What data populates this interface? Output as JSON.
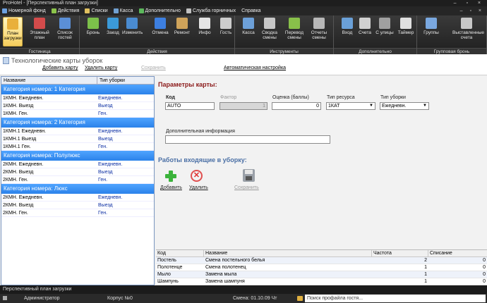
{
  "window": {
    "title": "ProHotel - [Перспективный план загрузки]",
    "controls": "– ▫ ×"
  },
  "menu": [
    {
      "label": "Номерной фонд",
      "color": "#6ca0e0"
    },
    {
      "label": "Действия",
      "color": "#8bc34a"
    },
    {
      "label": "Списки",
      "color": "#e0c060"
    },
    {
      "label": "Касса",
      "color": "#70a0d0"
    },
    {
      "label": "Дополнительно",
      "color": "#5cb85c"
    },
    {
      "label": "Служба горничных",
      "color": "#c0c0c0"
    },
    {
      "label": "Справка",
      "color": ""
    }
  ],
  "ribbon": {
    "groups": [
      "Гостиница",
      "Действия",
      "Инструменты",
      "Дополнительно",
      "Групповая бронь"
    ],
    "buttons": [
      {
        "label": "План загрузки",
        "color": "#e9b03b"
      },
      {
        "label": "Этажный план",
        "color": "#d34b4b"
      },
      {
        "label": "Список гостей",
        "color": "#5b8fd6"
      },
      {
        "label": "Бронь",
        "color": "#7cc04a"
      },
      {
        "label": "Заезд",
        "color": "#3b9ad9"
      },
      {
        "label": "Изменить",
        "color": "#4a8bd0"
      },
      {
        "label": "Отмена",
        "color": "#3d7fe0"
      },
      {
        "label": "Ремонт",
        "color": "#cfa35a"
      },
      {
        "label": "Инфо",
        "color": "#e4e4e4"
      },
      {
        "label": "Гость",
        "color": "#cccccc"
      },
      {
        "label": "Касса",
        "color": "#6da0d8"
      },
      {
        "label": "Сводка смены",
        "color": "#c8c8c8"
      },
      {
        "label": "Перевод смены",
        "color": "#88c04a"
      },
      {
        "label": "Отчеты смены",
        "color": "#b8b8b8"
      },
      {
        "label": "Вход",
        "color": "#6aa0d8"
      },
      {
        "label": "Счета",
        "color": "#d0d0d0"
      },
      {
        "label": "С улицы",
        "color": "#a0a0a0"
      },
      {
        "label": "Таймер",
        "color": "#e0e0e0"
      },
      {
        "label": "Группы",
        "color": "#7aa8e0"
      },
      {
        "label": "Выставленные счета",
        "color": "#c8c8c8"
      }
    ]
  },
  "header": {
    "title": "Технологические карты уборок",
    "add_card": "Добавить карту",
    "del_card": "Удалить карту",
    "save": "Сохранить",
    "auto": "Автоматическая настройка"
  },
  "grid": {
    "columns": [
      "Название",
      "Тип уборки"
    ],
    "categories": [
      {
        "title": "Категория номера: 1 Категория",
        "rows": [
          [
            "1КМН. Ежедневн.",
            "Ежедневн."
          ],
          [
            "1КМН. Выезд",
            "Выезд"
          ],
          [
            "1КМН. Ген.",
            "Ген."
          ]
        ]
      },
      {
        "title": "Категория номера: 2 Категория",
        "rows": [
          [
            "1КМН.1 Ежедневн.",
            "Ежедневн."
          ],
          [
            "1КМН.1 Выезд",
            "Выезд"
          ],
          [
            "1КМН.1 Ген.",
            "Ген."
          ]
        ]
      },
      {
        "title": "Категория номера: Полулюкс",
        "rows": [
          [
            "2КМН. Ежедневн.",
            "Ежедневн."
          ],
          [
            "2КМН. Выезд",
            "Выезд"
          ],
          [
            "2КМН. Ген.",
            "Ген."
          ]
        ]
      },
      {
        "title": "Категория номера: Люкс",
        "rows": [
          [
            "2КМН. Ежедневн.",
            "Ежедневн."
          ],
          [
            "2КМН. Выезд",
            "Выезд"
          ],
          [
            "2КМН. Ген.",
            "Ген."
          ]
        ]
      }
    ]
  },
  "form": {
    "params_title": "Параметры карты:",
    "code_label": "Код",
    "code": "AUTO",
    "factor_label": "Фактор",
    "factor": "1",
    "score_label": "Оценка (баллы)",
    "score": "0",
    "resource_label": "Тип ресурса",
    "resource": "1КАТ",
    "cleaning_label": "Тип уборки",
    "cleaning": "Ежедневн.",
    "info_label": "Дополнительная информация",
    "info": "",
    "works_title": "Работы входящие в уборку:",
    "add": "Добавить",
    "remove": "Удалить",
    "save": "Сохранить"
  },
  "works": {
    "columns": [
      "Код",
      "Название",
      "Частота",
      "Списание"
    ],
    "rows": [
      [
        "Постель",
        "Смена постельного белья",
        "2",
        "0"
      ],
      [
        "Полотенце",
        "Смена полотенец",
        "1",
        "0"
      ],
      [
        "Мыло",
        "Замена мыла",
        "1",
        "0"
      ],
      [
        "Шампунь",
        "Замена шампуня",
        "1",
        "0"
      ]
    ]
  },
  "status": {
    "plan": "Перспективный план загрузки",
    "user": "Администратор",
    "building": "Корпус №0",
    "shift": "Смена: 01.10.09 Чт",
    "search": "Поиск профайла гостя..."
  }
}
